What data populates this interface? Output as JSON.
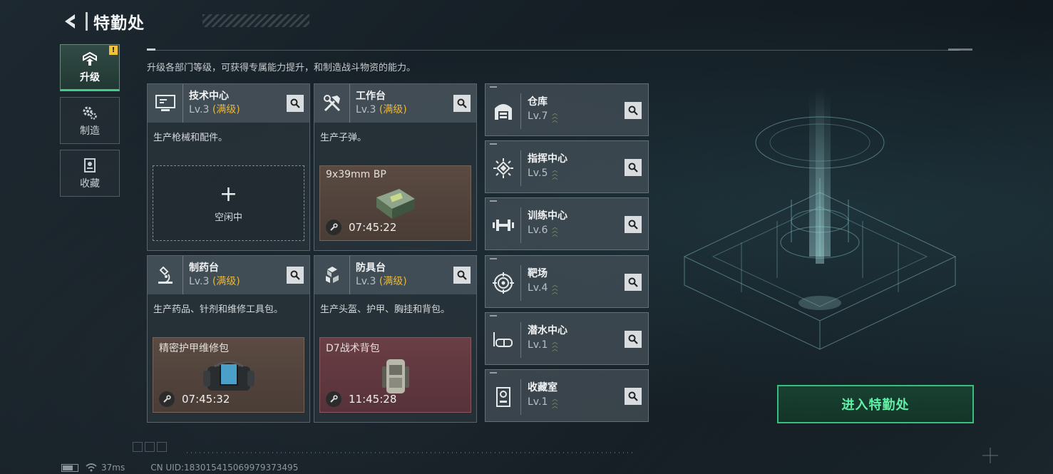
{
  "header": {
    "title": "特勤处"
  },
  "nav": [
    {
      "label": "升级",
      "active": true,
      "alert": "!"
    },
    {
      "label": "制造",
      "active": false
    },
    {
      "label": "收藏",
      "active": false
    }
  ],
  "subtitle": "升级各部门等级，可获得专属能力提升，和制造战斗物资的能力。",
  "stations": [
    {
      "name": "技术中心",
      "level": "Lv.3",
      "max_label": "(满级)",
      "desc": "生产枪械和配件。",
      "slot": {
        "type": "empty",
        "label": "空闲中"
      }
    },
    {
      "name": "工作台",
      "level": "Lv.3",
      "max_label": "(满级)",
      "desc": "生产子弹。",
      "slot": {
        "type": "item",
        "item": "9x39mm BP",
        "timer": "07:45:22"
      }
    },
    {
      "name": "制药台",
      "level": "Lv.3",
      "max_label": "(满级)",
      "desc": "生产药品、针剂和维修工具包。",
      "slot": {
        "type": "item",
        "item": "精密护甲维修包",
        "timer": "07:45:32"
      }
    },
    {
      "name": "防具台",
      "level": "Lv.3",
      "max_label": "(满级)",
      "desc": "生产头盔、护甲、胸挂和背包。",
      "slot": {
        "type": "item",
        "item": "D7战术背包",
        "timer": "11:45:28"
      }
    }
  ],
  "buildings": [
    {
      "name": "仓库",
      "level": "Lv.7",
      "icon": "warehouse-icon"
    },
    {
      "name": "指挥中心",
      "level": "Lv.5",
      "icon": "chip-icon"
    },
    {
      "name": "训练中心",
      "level": "Lv.6",
      "icon": "dumbbell-icon"
    },
    {
      "name": "靶场",
      "level": "Lv.4",
      "icon": "target-icon"
    },
    {
      "name": "潜水中心",
      "level": "Lv.1",
      "icon": "diving-mask-icon"
    },
    {
      "name": "收藏室",
      "level": "Lv.1",
      "icon": "collection-icon"
    }
  ],
  "enter_button": "进入特勤处",
  "status": {
    "ping": "37ms",
    "uid": "CN UID:183015415069979373495"
  },
  "colors": {
    "accent_green": "#36c07e",
    "max_gold": "#e8b63c",
    "slot_brown": "#5a4a42",
    "slot_red": "#6a3e45"
  }
}
